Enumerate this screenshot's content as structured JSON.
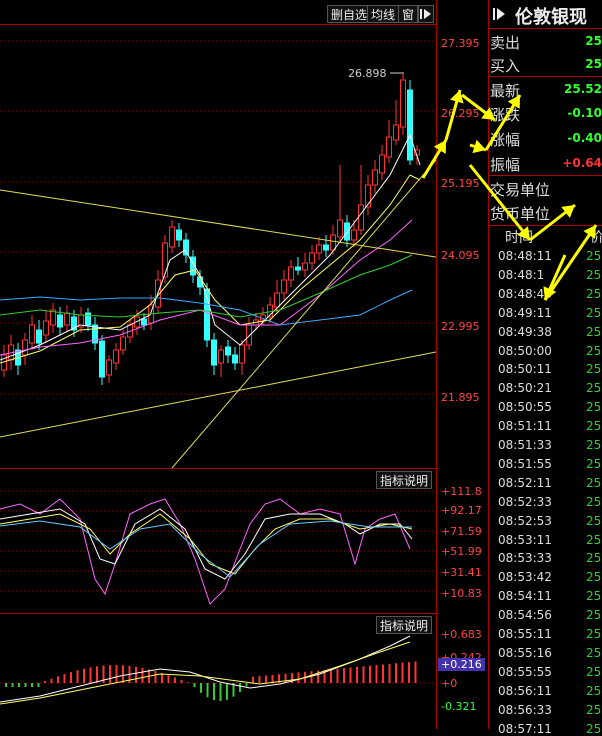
{
  "toolbar": {
    "delete_watch_label": "删自选",
    "ma_label": "均线",
    "window_label": "窗",
    "collapse_icon": "play-right-icon"
  },
  "main_chart": {
    "price_ticks": [
      "27.395",
      "26.295",
      "25.195",
      "24.095",
      "22.995",
      "21.895"
    ],
    "high_label": "26.898",
    "colors": {
      "up": "#ff3333",
      "down": "#33ffff",
      "line_white": "#ffffff",
      "line_yellow": "#ffff66",
      "line_magenta": "#ff66ff",
      "line_green": "#33cc33",
      "line_cyan": "#33aaff",
      "grid": "#8b0000"
    }
  },
  "indicator1": {
    "explain_label": "指标说明",
    "ticks": [
      "+111.8",
      "+92.17",
      "+71.59",
      "+51.99",
      "+31.41",
      "+10.83"
    ]
  },
  "indicator2": {
    "explain_label": "指标说明",
    "ticks": [
      "+0.683",
      "+0.242",
      "+0.216",
      "+0",
      "-0.321"
    ]
  },
  "quote_panel": {
    "title": "伦敦银现",
    "rows": [
      {
        "label": "卖出",
        "value": "25",
        "color": "#33ff33"
      },
      {
        "label": "买入",
        "value": "25",
        "color": "#33ff33"
      },
      {
        "label": "最新",
        "value": "25.52",
        "color": "#33ff33"
      },
      {
        "label": "涨跌",
        "value": "-0.10",
        "color": "#33ff33"
      },
      {
        "label": "涨幅",
        "value": "-0.40",
        "color": "#33ff33"
      },
      {
        "label": "振幅",
        "value": "+0.64",
        "color": "#ff3333"
      }
    ],
    "trade_unit_label": "交易单位",
    "currency_unit_label": "货币单位",
    "ticks_header_time": "时间",
    "ticks_header_price": "价"
  },
  "time_sales": [
    {
      "time": "08:48:11",
      "price": "25"
    },
    {
      "time": "08:48:1",
      "price": "25"
    },
    {
      "time": "08:48:43",
      "price": "25"
    },
    {
      "time": "08:49:11",
      "price": "25"
    },
    {
      "time": "08:49:38",
      "price": "25"
    },
    {
      "time": "08:50:00",
      "price": "25"
    },
    {
      "time": "08:50:11",
      "price": "25"
    },
    {
      "time": "08:50:21",
      "price": "25"
    },
    {
      "time": "08:50:55",
      "price": "25"
    },
    {
      "time": "08:51:11",
      "price": "25"
    },
    {
      "time": "08:51:33",
      "price": "25"
    },
    {
      "time": "08:51:55",
      "price": "25"
    },
    {
      "time": "08:52:11",
      "price": "25"
    },
    {
      "time": "08:52:33",
      "price": "25"
    },
    {
      "time": "08:52:53",
      "price": "25"
    },
    {
      "time": "08:53:11",
      "price": "25"
    },
    {
      "time": "08:53:33",
      "price": "25"
    },
    {
      "time": "08:53:42",
      "price": "25"
    },
    {
      "time": "08:54:11",
      "price": "25"
    },
    {
      "time": "08:54:56",
      "price": "25"
    },
    {
      "time": "08:55:11",
      "price": "25"
    },
    {
      "time": "08:55:16",
      "price": "25"
    },
    {
      "time": "08:55:55",
      "price": "25"
    },
    {
      "time": "08:56:11",
      "price": "25"
    },
    {
      "time": "08:56:33",
      "price": "25"
    },
    {
      "time": "08:57:11",
      "price": "25"
    }
  ]
}
